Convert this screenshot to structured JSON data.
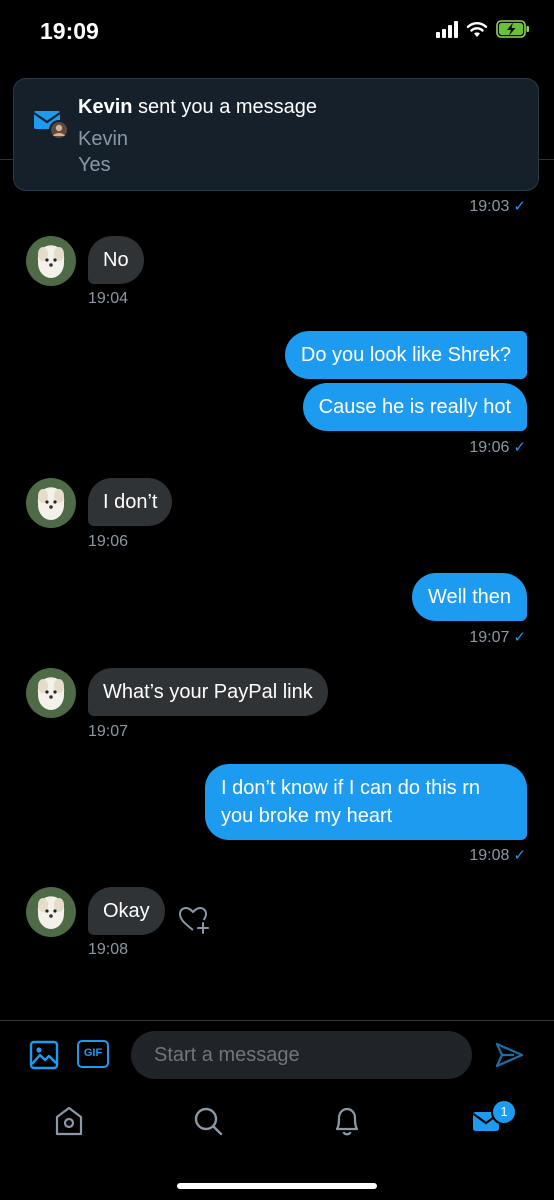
{
  "status_bar": {
    "time": "19:09"
  },
  "notification": {
    "title_name": "Kevin",
    "title_rest": " sent you a message",
    "sender": "Kevin",
    "body": "Yes"
  },
  "thread": {
    "first_timestamp": "19:03",
    "messages": [
      {
        "dir": "in",
        "text": "No",
        "time": "19:04"
      },
      {
        "dir": "out",
        "text": "Do you look like Shrek?"
      },
      {
        "dir": "out",
        "text": "Cause he is really hot",
        "time": "19:06"
      },
      {
        "dir": "in",
        "text": "I don’t",
        "time": "19:06"
      },
      {
        "dir": "out",
        "text": "Well then",
        "time": "19:07"
      },
      {
        "dir": "in",
        "text": "What’s your PayPal link",
        "time": "19:07"
      },
      {
        "dir": "out",
        "text": "I don’t know if I can do this rn you broke my heart",
        "time": "19:08"
      },
      {
        "dir": "in",
        "text": "Okay",
        "time": "19:08"
      }
    ]
  },
  "composer": {
    "placeholder": "Start a message",
    "gif_label": "GIF"
  },
  "tabbar": {
    "items": [
      "home-icon",
      "search-icon",
      "bell-icon",
      "mail-icon"
    ],
    "messages_badge": "1"
  },
  "colors": {
    "accent": "#1d9bf0",
    "background": "#000000",
    "incoming_bubble": "#2f3336"
  }
}
